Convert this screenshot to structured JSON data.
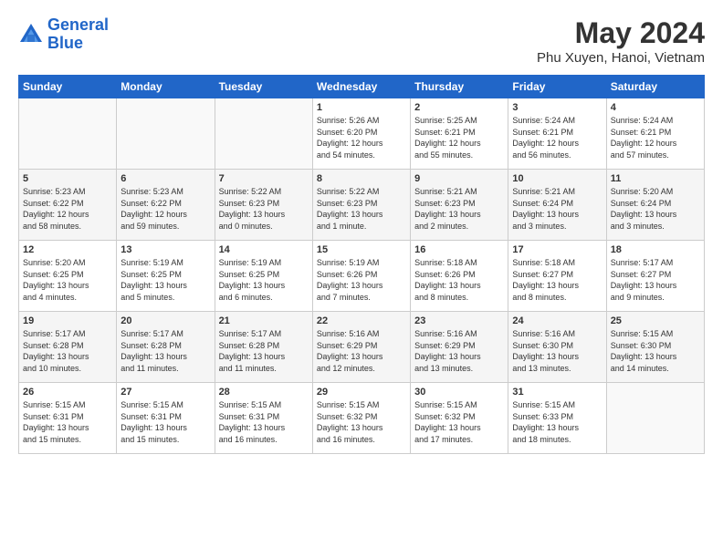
{
  "header": {
    "logo_line1": "General",
    "logo_line2": "Blue",
    "main_title": "May 2024",
    "subtitle": "Phu Xuyen, Hanoi, Vietnam"
  },
  "days_of_week": [
    "Sunday",
    "Monday",
    "Tuesday",
    "Wednesday",
    "Thursday",
    "Friday",
    "Saturday"
  ],
  "weeks": [
    [
      {
        "num": "",
        "info": ""
      },
      {
        "num": "",
        "info": ""
      },
      {
        "num": "",
        "info": ""
      },
      {
        "num": "1",
        "info": "Sunrise: 5:26 AM\nSunset: 6:20 PM\nDaylight: 12 hours\nand 54 minutes."
      },
      {
        "num": "2",
        "info": "Sunrise: 5:25 AM\nSunset: 6:21 PM\nDaylight: 12 hours\nand 55 minutes."
      },
      {
        "num": "3",
        "info": "Sunrise: 5:24 AM\nSunset: 6:21 PM\nDaylight: 12 hours\nand 56 minutes."
      },
      {
        "num": "4",
        "info": "Sunrise: 5:24 AM\nSunset: 6:21 PM\nDaylight: 12 hours\nand 57 minutes."
      }
    ],
    [
      {
        "num": "5",
        "info": "Sunrise: 5:23 AM\nSunset: 6:22 PM\nDaylight: 12 hours\nand 58 minutes."
      },
      {
        "num": "6",
        "info": "Sunrise: 5:23 AM\nSunset: 6:22 PM\nDaylight: 12 hours\nand 59 minutes."
      },
      {
        "num": "7",
        "info": "Sunrise: 5:22 AM\nSunset: 6:23 PM\nDaylight: 13 hours\nand 0 minutes."
      },
      {
        "num": "8",
        "info": "Sunrise: 5:22 AM\nSunset: 6:23 PM\nDaylight: 13 hours\nand 1 minute."
      },
      {
        "num": "9",
        "info": "Sunrise: 5:21 AM\nSunset: 6:23 PM\nDaylight: 13 hours\nand 2 minutes."
      },
      {
        "num": "10",
        "info": "Sunrise: 5:21 AM\nSunset: 6:24 PM\nDaylight: 13 hours\nand 3 minutes."
      },
      {
        "num": "11",
        "info": "Sunrise: 5:20 AM\nSunset: 6:24 PM\nDaylight: 13 hours\nand 3 minutes."
      }
    ],
    [
      {
        "num": "12",
        "info": "Sunrise: 5:20 AM\nSunset: 6:25 PM\nDaylight: 13 hours\nand 4 minutes."
      },
      {
        "num": "13",
        "info": "Sunrise: 5:19 AM\nSunset: 6:25 PM\nDaylight: 13 hours\nand 5 minutes."
      },
      {
        "num": "14",
        "info": "Sunrise: 5:19 AM\nSunset: 6:25 PM\nDaylight: 13 hours\nand 6 minutes."
      },
      {
        "num": "15",
        "info": "Sunrise: 5:19 AM\nSunset: 6:26 PM\nDaylight: 13 hours\nand 7 minutes."
      },
      {
        "num": "16",
        "info": "Sunrise: 5:18 AM\nSunset: 6:26 PM\nDaylight: 13 hours\nand 8 minutes."
      },
      {
        "num": "17",
        "info": "Sunrise: 5:18 AM\nSunset: 6:27 PM\nDaylight: 13 hours\nand 8 minutes."
      },
      {
        "num": "18",
        "info": "Sunrise: 5:17 AM\nSunset: 6:27 PM\nDaylight: 13 hours\nand 9 minutes."
      }
    ],
    [
      {
        "num": "19",
        "info": "Sunrise: 5:17 AM\nSunset: 6:28 PM\nDaylight: 13 hours\nand 10 minutes."
      },
      {
        "num": "20",
        "info": "Sunrise: 5:17 AM\nSunset: 6:28 PM\nDaylight: 13 hours\nand 11 minutes."
      },
      {
        "num": "21",
        "info": "Sunrise: 5:17 AM\nSunset: 6:28 PM\nDaylight: 13 hours\nand 11 minutes."
      },
      {
        "num": "22",
        "info": "Sunrise: 5:16 AM\nSunset: 6:29 PM\nDaylight: 13 hours\nand 12 minutes."
      },
      {
        "num": "23",
        "info": "Sunrise: 5:16 AM\nSunset: 6:29 PM\nDaylight: 13 hours\nand 13 minutes."
      },
      {
        "num": "24",
        "info": "Sunrise: 5:16 AM\nSunset: 6:30 PM\nDaylight: 13 hours\nand 13 minutes."
      },
      {
        "num": "25",
        "info": "Sunrise: 5:15 AM\nSunset: 6:30 PM\nDaylight: 13 hours\nand 14 minutes."
      }
    ],
    [
      {
        "num": "26",
        "info": "Sunrise: 5:15 AM\nSunset: 6:31 PM\nDaylight: 13 hours\nand 15 minutes."
      },
      {
        "num": "27",
        "info": "Sunrise: 5:15 AM\nSunset: 6:31 PM\nDaylight: 13 hours\nand 15 minutes."
      },
      {
        "num": "28",
        "info": "Sunrise: 5:15 AM\nSunset: 6:31 PM\nDaylight: 13 hours\nand 16 minutes."
      },
      {
        "num": "29",
        "info": "Sunrise: 5:15 AM\nSunset: 6:32 PM\nDaylight: 13 hours\nand 16 minutes."
      },
      {
        "num": "30",
        "info": "Sunrise: 5:15 AM\nSunset: 6:32 PM\nDaylight: 13 hours\nand 17 minutes."
      },
      {
        "num": "31",
        "info": "Sunrise: 5:15 AM\nSunset: 6:33 PM\nDaylight: 13 hours\nand 18 minutes."
      },
      {
        "num": "",
        "info": ""
      }
    ]
  ]
}
